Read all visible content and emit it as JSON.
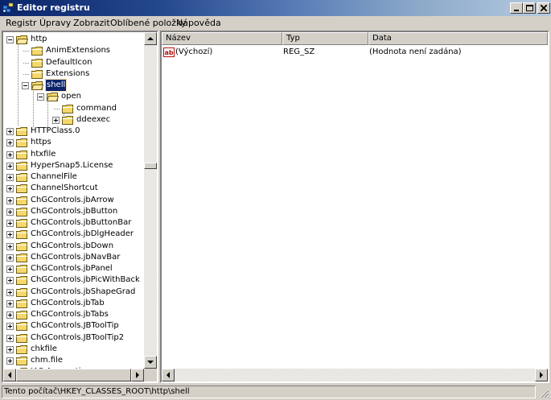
{
  "window": {
    "title": "Editor registru"
  },
  "menu": [
    {
      "label": "Registr"
    },
    {
      "label": "Úpravy"
    },
    {
      "label": "Zobrazit"
    },
    {
      "label": "Oblíbené položky"
    },
    {
      "label": "Nápověda"
    }
  ],
  "tree": {
    "items": [
      {
        "label": "http",
        "expander": "minus",
        "open": true,
        "selected": false
      },
      {
        "label": "AnimExtensions",
        "expander": "none",
        "open": false,
        "selected": false
      },
      {
        "label": "DefaultIcon",
        "expander": "none",
        "open": false,
        "selected": false
      },
      {
        "label": "Extensions",
        "expander": "none",
        "open": false,
        "selected": false
      },
      {
        "label": "shell",
        "expander": "minus",
        "open": true,
        "selected": true
      },
      {
        "label": "open",
        "expander": "minus",
        "open": true,
        "selected": false
      },
      {
        "label": "command",
        "expander": "none",
        "open": false,
        "selected": false
      },
      {
        "label": "ddeexec",
        "expander": "plus",
        "open": false,
        "selected": false
      },
      {
        "label": "HTTPClass.0",
        "expander": "plus",
        "open": false,
        "selected": false
      },
      {
        "label": "https",
        "expander": "plus",
        "open": false,
        "selected": false
      },
      {
        "label": "htxfile",
        "expander": "plus",
        "open": false,
        "selected": false
      },
      {
        "label": "HyperSnap5.License",
        "expander": "plus",
        "open": false,
        "selected": false
      },
      {
        "label": "ChannelFile",
        "expander": "plus",
        "open": false,
        "selected": false
      },
      {
        "label": "ChannelShortcut",
        "expander": "plus",
        "open": false,
        "selected": false
      },
      {
        "label": "ChGControls.jbArrow",
        "expander": "plus",
        "open": false,
        "selected": false
      },
      {
        "label": "ChGControls.jbButton",
        "expander": "plus",
        "open": false,
        "selected": false
      },
      {
        "label": "ChGControls.jbButtonBar",
        "expander": "plus",
        "open": false,
        "selected": false
      },
      {
        "label": "ChGControls.jbDlgHeader",
        "expander": "plus",
        "open": false,
        "selected": false
      },
      {
        "label": "ChGControls.jbDown",
        "expander": "plus",
        "open": false,
        "selected": false
      },
      {
        "label": "ChGControls.jbNavBar",
        "expander": "plus",
        "open": false,
        "selected": false
      },
      {
        "label": "ChGControls.jbPanel",
        "expander": "plus",
        "open": false,
        "selected": false
      },
      {
        "label": "ChGControls.jbPicWithBack",
        "expander": "plus",
        "open": false,
        "selected": false
      },
      {
        "label": "ChGControls.jbShapeGrad",
        "expander": "plus",
        "open": false,
        "selected": false
      },
      {
        "label": "ChGControls.jbTab",
        "expander": "plus",
        "open": false,
        "selected": false
      },
      {
        "label": "ChGControls.jbTabs",
        "expander": "plus",
        "open": false,
        "selected": false
      },
      {
        "label": "ChGControls.JBToolTip",
        "expander": "plus",
        "open": false,
        "selected": false
      },
      {
        "label": "ChGControls.JBToolTip2",
        "expander": "plus",
        "open": false,
        "selected": false
      },
      {
        "label": "chkfile",
        "expander": "plus",
        "open": false,
        "selected": false
      },
      {
        "label": "chm.file",
        "expander": "plus",
        "open": false,
        "selected": false
      },
      {
        "label": "IAS.Accounting",
        "expander": "plus",
        "open": false,
        "selected": false
      }
    ]
  },
  "list": {
    "columns": [
      {
        "label": "Název"
      },
      {
        "label": "Typ"
      },
      {
        "label": "Data"
      }
    ],
    "rows": [
      {
        "icon": "string-value-icon",
        "name": "(Výchozí)",
        "type": "REG_SZ",
        "data": "(Hodnota není zadána)"
      }
    ]
  },
  "status": {
    "path": "Tento počítač\\HKEY_CLASSES_ROOT\\http\\shell"
  },
  "colors": {
    "titlebar": "#0a246a",
    "selection": "#0a246a",
    "face": "#d4d0c8",
    "folder": "#f4d86c"
  }
}
